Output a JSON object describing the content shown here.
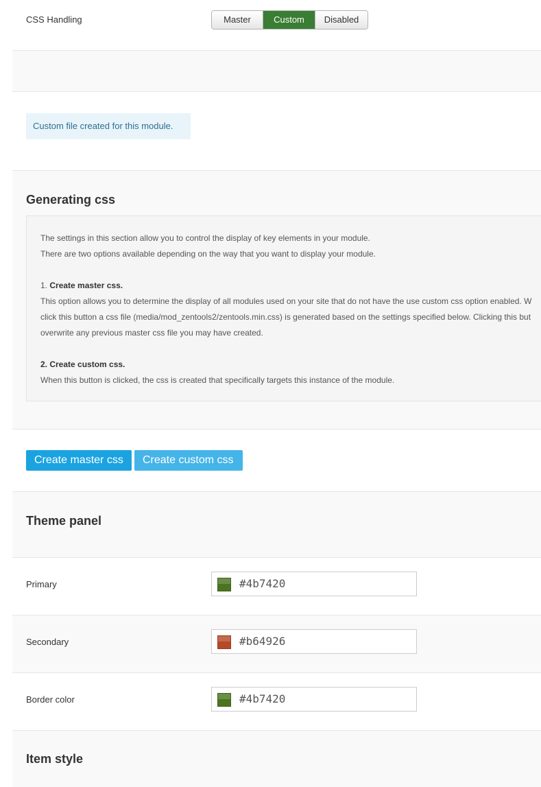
{
  "css_handling": {
    "label": "CSS Handling",
    "options": [
      "Master",
      "Custom",
      "Disabled"
    ],
    "selected": "Custom"
  },
  "alert": {
    "text": "Custom file created for this module."
  },
  "generating_css": {
    "title": "Generating css",
    "intro_1": "The settings in this section allow you to control the display of key elements in your module.",
    "intro_2": "There are two options available depending on the way that you want to display your module.",
    "step1_number": "1.",
    "step1_title": "Create master css.",
    "step1_line1": "This option allows you to determine the display of all modules used on your site that do not have the use custom css option enabled. W",
    "step1_line2": "click this button a css file (media/mod_zentools2/zentools.min.css) is generated based on the settings specified below. Clicking this but",
    "step1_line3": "overwrite any previous master css file you may have created.",
    "step2_title": "2. Create custom css.",
    "step2_line1": "When this button is clicked, the css is created that specifically targets this instance of the module."
  },
  "buttons": {
    "master": "Create master css",
    "custom": "Create custom css"
  },
  "theme_panel": {
    "title": "Theme panel",
    "fields": [
      {
        "label": "Primary",
        "value": "#4b7420",
        "color": "#4b7420"
      },
      {
        "label": "Secondary",
        "value": "#b64926",
        "color": "#b64926"
      },
      {
        "label": "Border color",
        "value": "#4b7420",
        "color": "#4b7420"
      }
    ]
  },
  "item_style": {
    "title": "Item style"
  },
  "colors": {
    "active_green": "#3a7d34",
    "button_blue": "#1aa3e0",
    "button_blue_light": "#45b4e8",
    "alert_bg": "#e8f4fa",
    "alert_text": "#2f6f8e"
  }
}
